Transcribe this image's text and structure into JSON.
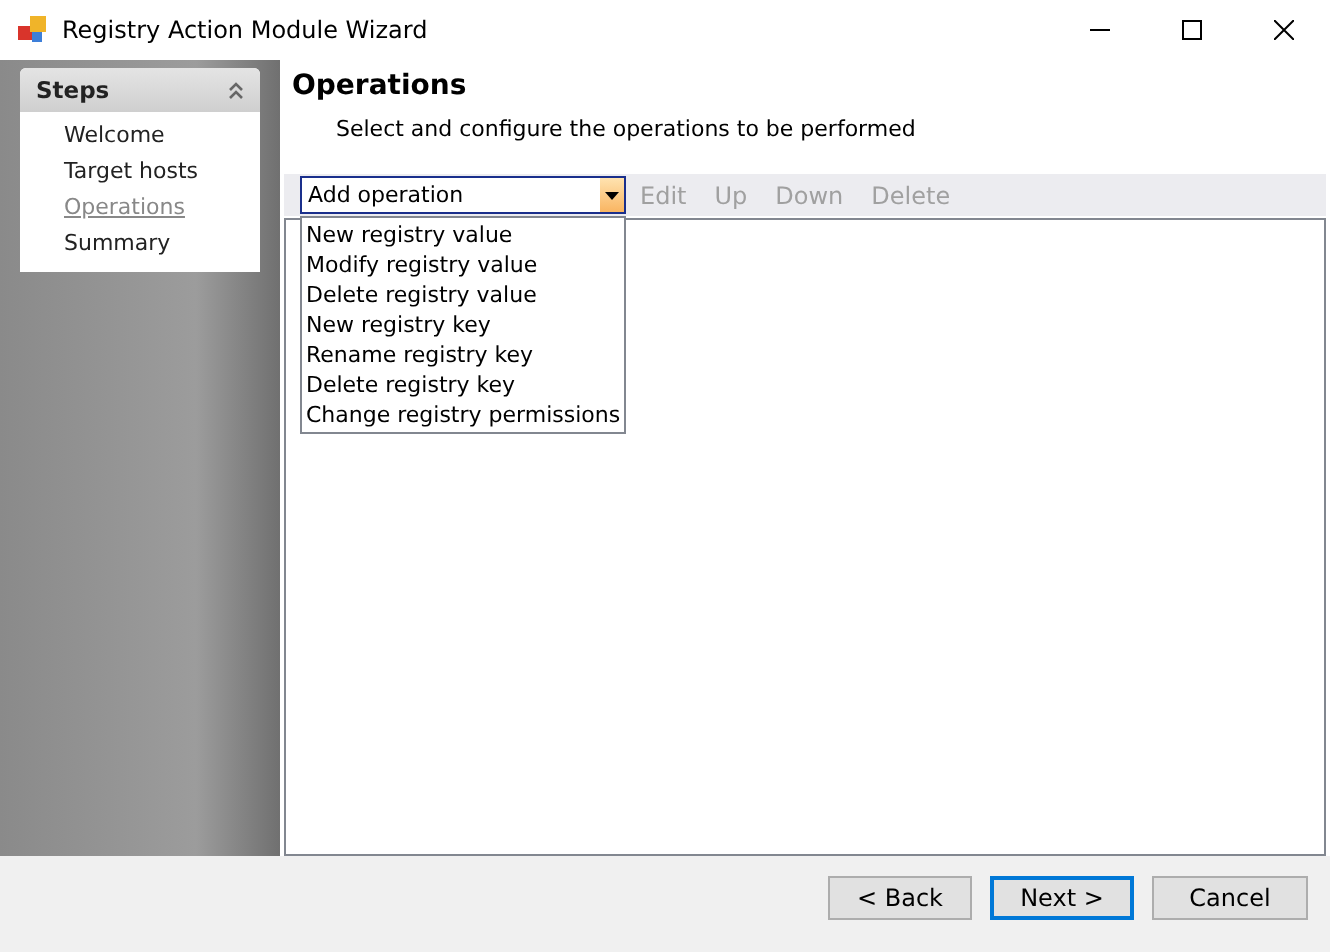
{
  "window": {
    "title": "Registry Action Module Wizard"
  },
  "steps_panel": {
    "title": "Steps",
    "items": [
      {
        "label": "Welcome",
        "selected": false
      },
      {
        "label": "Target hosts",
        "selected": false
      },
      {
        "label": "Operations",
        "selected": true
      },
      {
        "label": "Summary",
        "selected": false
      }
    ]
  },
  "page": {
    "title": "Operations",
    "subtitle": "Select and configure the operations to be performed"
  },
  "toolbar": {
    "combo": {
      "value": "Add operation",
      "expanded": true
    },
    "buttons": [
      {
        "label": "Edit",
        "disabled": true
      },
      {
        "label": "Up",
        "disabled": true
      },
      {
        "label": "Down",
        "disabled": true
      },
      {
        "label": "Delete",
        "disabled": true
      }
    ]
  },
  "dropdown_options": [
    "New registry value",
    "Modify registry value",
    "Delete registry value",
    "New registry key",
    "Rename registry key",
    "Delete registry key",
    "Change registry permissions"
  ],
  "buttons": [
    {
      "label": "< Back",
      "default": false
    },
    {
      "label": "Next >",
      "default": true
    },
    {
      "label": "Cancel",
      "default": false
    }
  ]
}
